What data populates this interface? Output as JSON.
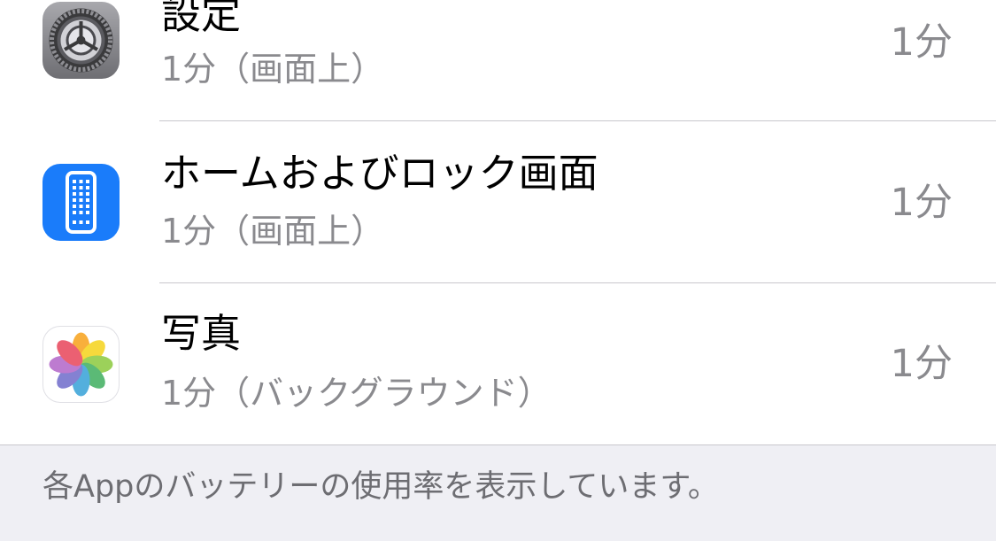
{
  "rows": [
    {
      "title": "設定",
      "subtitle": "1分（画面上）",
      "time": "1分",
      "icon": "settings-gear-icon",
      "icon_bg": "#8e8e93"
    },
    {
      "title": "ホームおよびロック画面",
      "subtitle": "1分（画面上）",
      "time": "1分",
      "icon": "home-lock-screen-phone-icon",
      "icon_bg": "#1a7cfa"
    },
    {
      "title": "写真",
      "subtitle": "1分（バックグラウンド）",
      "time": "1分",
      "icon": "photos-flower-icon",
      "icon_bg": "#ffffff"
    }
  ],
  "footer": {
    "note": "各Appのバッテリーの使用率を表示しています。"
  },
  "colors": {
    "title": "#000000",
    "secondary": "#8a8a8e",
    "footer_bg": "#efeff4",
    "separator": "#c8c7cc"
  }
}
